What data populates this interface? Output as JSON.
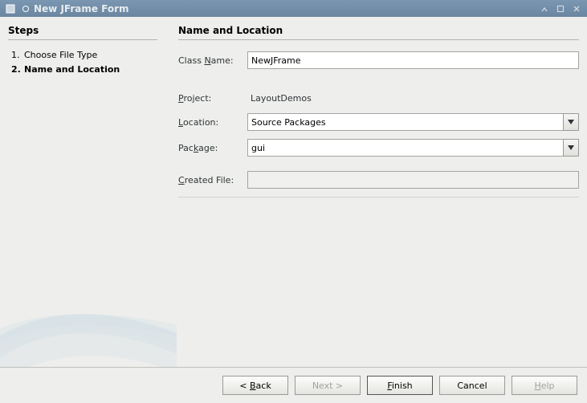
{
  "window": {
    "title": "New JFrame Form"
  },
  "sidebar": {
    "heading": "Steps",
    "steps": [
      {
        "num": "1.",
        "label": "Choose File Type"
      },
      {
        "num": "2.",
        "label": "Name and Location"
      }
    ]
  },
  "main": {
    "heading": "Name and Location",
    "labels": {
      "className": "Class Name:",
      "project": "Project:",
      "location": "Location:",
      "package": "Package:",
      "createdFile": "Created File:"
    },
    "values": {
      "className": "NewJFrame",
      "project": "LayoutDemos",
      "location": "Source Packages",
      "package": "gui",
      "createdFile": ""
    }
  },
  "footer": {
    "back": "< Back",
    "next": "Next >",
    "finish": "Finish",
    "cancel": "Cancel",
    "help": "Help"
  }
}
